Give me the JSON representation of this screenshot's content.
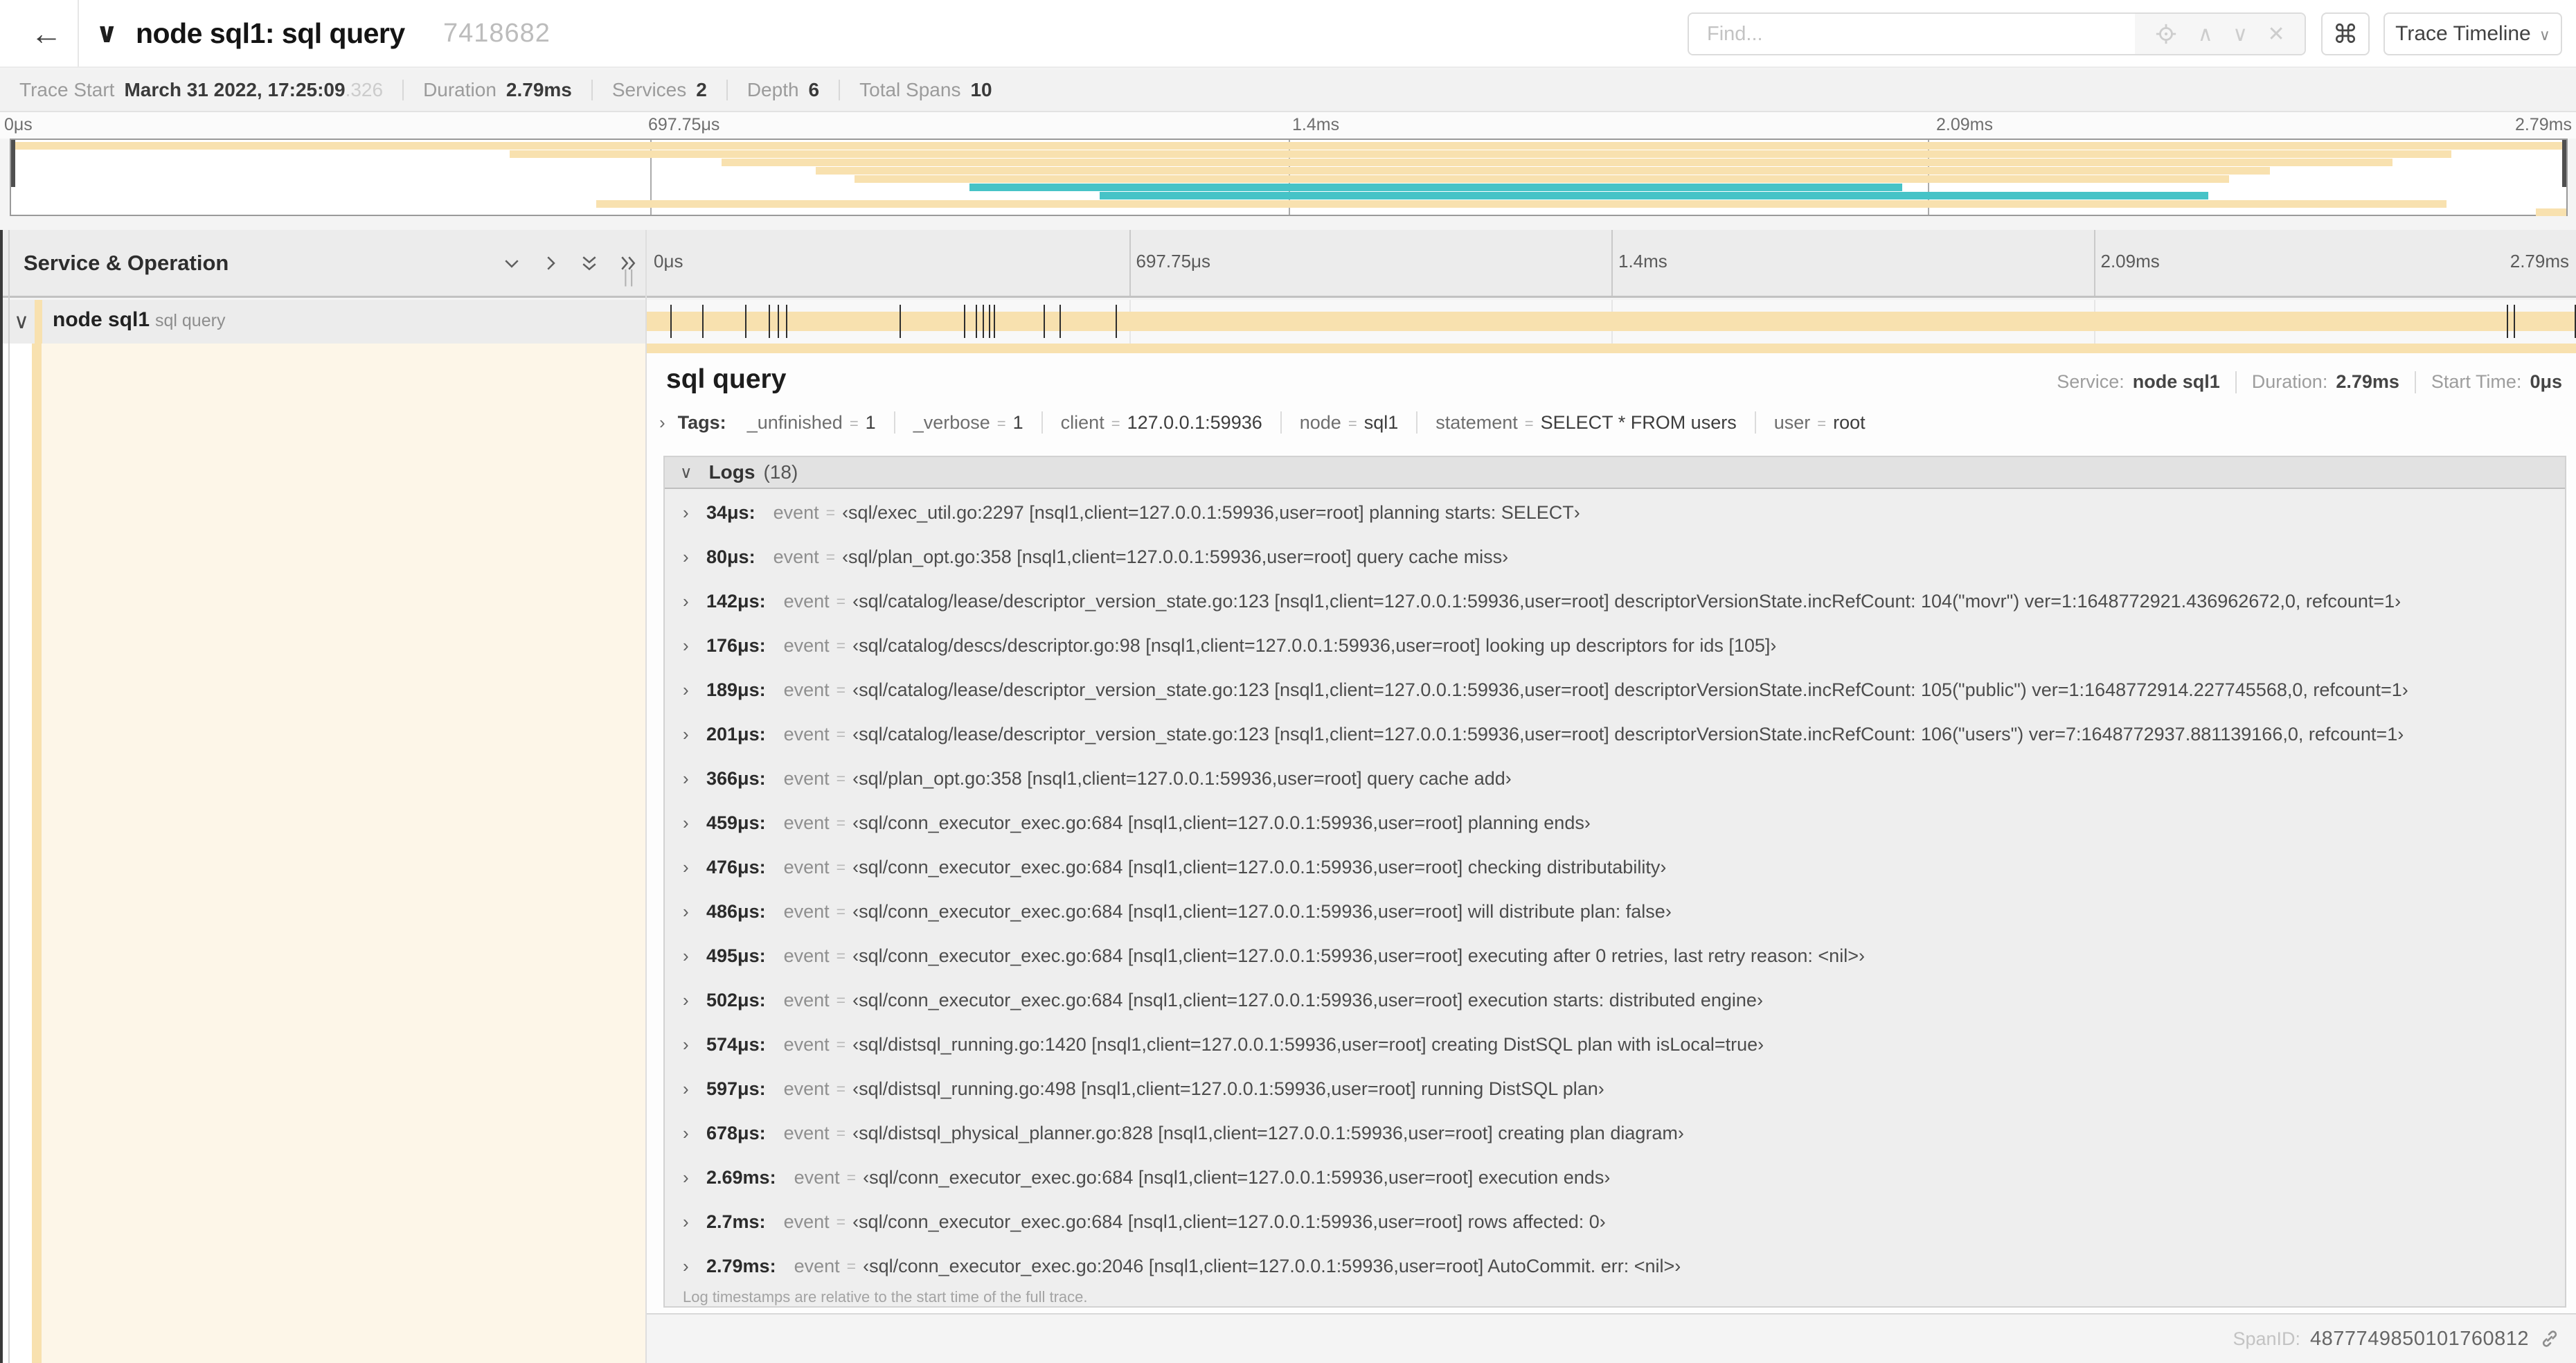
{
  "colors": {
    "tan": "#f8e1af",
    "teal": "#46c3c7",
    "cream": "#fdf6e8"
  },
  "header": {
    "title": "node sql1: sql query",
    "trace_id": "7418682",
    "find_placeholder": "Find...",
    "cmd_glyph": "⌘",
    "view_selector": "Trace Timeline"
  },
  "icons": {
    "back": "←",
    "title_chevron": "∨",
    "find_up": "∧",
    "find_down": "∨",
    "find_close": "✕",
    "caret_down": "∨",
    "chevron_down": "∨",
    "chevron_right": "›",
    "resize_grip": "||"
  },
  "summary": {
    "items": [
      {
        "label": "Trace Start",
        "value": "March 31 2022, 17:25:09",
        "muted": ".326"
      },
      {
        "label": "Duration",
        "value": "2.79ms",
        "muted": ""
      },
      {
        "label": "Services",
        "value": "2",
        "muted": ""
      },
      {
        "label": "Depth",
        "value": "6",
        "muted": ""
      },
      {
        "label": "Total Spans",
        "value": "10",
        "muted": ""
      }
    ]
  },
  "minimap": {
    "ticks": [
      "0μs",
      "697.75μs",
      "1.4ms",
      "2.09ms",
      "2.79ms"
    ],
    "spans": [
      {
        "start": 0,
        "end": 1,
        "color": "tan"
      },
      {
        "start": 0.195,
        "end": 0.955,
        "color": "tan"
      },
      {
        "start": 0.278,
        "end": 0.932,
        "color": "tan"
      },
      {
        "start": 0.315,
        "end": 0.884,
        "color": "tan"
      },
      {
        "start": 0.33,
        "end": 0.868,
        "color": "tan"
      },
      {
        "start": 0.375,
        "end": 0.74,
        "color": "teal"
      },
      {
        "start": 0.426,
        "end": 0.86,
        "color": "teal"
      },
      {
        "start": 0.229,
        "end": 0.953,
        "color": "tan"
      },
      {
        "start": 0.988,
        "end": 1,
        "color": "tan"
      }
    ]
  },
  "timeline": {
    "left_header": "Service & Operation",
    "ticks": [
      "0μs",
      "697.75μs",
      "1.4ms",
      "2.09ms",
      "2.79ms"
    ],
    "duration_us": 2790,
    "row": {
      "service": "node sql1",
      "operation": "sql query"
    }
  },
  "detail": {
    "title": "sql query",
    "meta": [
      {
        "label": "Service:",
        "value": "node sql1"
      },
      {
        "label": "Duration:",
        "value": "2.79ms"
      },
      {
        "label": "Start Time:",
        "value": "0μs"
      }
    ],
    "tags_label": "Tags:",
    "eq": "=",
    "tags": [
      {
        "key": "_unfinished",
        "value": "1"
      },
      {
        "key": "_verbose",
        "value": "1"
      },
      {
        "key": "client",
        "value": "127.0.0.1:59936"
      },
      {
        "key": "node",
        "value": "sql1"
      },
      {
        "key": "statement",
        "value": "SELECT * FROM users"
      },
      {
        "key": "user",
        "value": "root"
      }
    ],
    "logs_label": "Logs",
    "logs_count": "(18)",
    "log_field": "event",
    "logs": [
      {
        "time": "34μs:",
        "us": 34,
        "msg": "‹sql/exec_util.go:2297 [nsql1,client=127.0.0.1:59936,user=root] planning starts: SELECT›"
      },
      {
        "time": "80μs:",
        "us": 80,
        "msg": "‹sql/plan_opt.go:358 [nsql1,client=127.0.0.1:59936,user=root] query cache miss›"
      },
      {
        "time": "142μs:",
        "us": 142,
        "msg": "‹sql/catalog/lease/descriptor_version_state.go:123 [nsql1,client=127.0.0.1:59936,user=root] descriptorVersionState.incRefCount: 104(\"movr\") ver=1:1648772921.436962672,0, refcount=1›"
      },
      {
        "time": "176μs:",
        "us": 176,
        "msg": "‹sql/catalog/descs/descriptor.go:98 [nsql1,client=127.0.0.1:59936,user=root] looking up descriptors for ids [105]›"
      },
      {
        "time": "189μs:",
        "us": 189,
        "msg": "‹sql/catalog/lease/descriptor_version_state.go:123 [nsql1,client=127.0.0.1:59936,user=root] descriptorVersionState.incRefCount: 105(\"public\") ver=1:1648772914.227745568,0, refcount=1›"
      },
      {
        "time": "201μs:",
        "us": 201,
        "msg": "‹sql/catalog/lease/descriptor_version_state.go:123 [nsql1,client=127.0.0.1:59936,user=root] descriptorVersionState.incRefCount: 106(\"users\") ver=7:1648772937.881139166,0, refcount=1›"
      },
      {
        "time": "366μs:",
        "us": 366,
        "msg": "‹sql/plan_opt.go:358 [nsql1,client=127.0.0.1:59936,user=root] query cache add›"
      },
      {
        "time": "459μs:",
        "us": 459,
        "msg": "‹sql/conn_executor_exec.go:684 [nsql1,client=127.0.0.1:59936,user=root] planning ends›"
      },
      {
        "time": "476μs:",
        "us": 476,
        "msg": "‹sql/conn_executor_exec.go:684 [nsql1,client=127.0.0.1:59936,user=root] checking distributability›"
      },
      {
        "time": "486μs:",
        "us": 486,
        "msg": "‹sql/conn_executor_exec.go:684 [nsql1,client=127.0.0.1:59936,user=root] will distribute plan: false›"
      },
      {
        "time": "495μs:",
        "us": 495,
        "msg": "‹sql/conn_executor_exec.go:684 [nsql1,client=127.0.0.1:59936,user=root] executing after 0 retries, last retry reason: <nil>›"
      },
      {
        "time": "502μs:",
        "us": 502,
        "msg": "‹sql/conn_executor_exec.go:684 [nsql1,client=127.0.0.1:59936,user=root] execution starts: distributed engine›"
      },
      {
        "time": "574μs:",
        "us": 574,
        "msg": "‹sql/distsql_running.go:1420 [nsql1,client=127.0.0.1:59936,user=root] creating DistSQL plan with isLocal=true›"
      },
      {
        "time": "597μs:",
        "us": 597,
        "msg": "‹sql/distsql_running.go:498 [nsql1,client=127.0.0.1:59936,user=root] running DistSQL plan›"
      },
      {
        "time": "678μs:",
        "us": 678,
        "msg": "‹sql/distsql_physical_planner.go:828 [nsql1,client=127.0.0.1:59936,user=root] creating plan diagram›"
      },
      {
        "time": "2.69ms:",
        "us": 2690,
        "msg": "‹sql/conn_executor_exec.go:684 [nsql1,client=127.0.0.1:59936,user=root] execution ends›"
      },
      {
        "time": "2.7ms:",
        "us": 2700,
        "msg": "‹sql/conn_executor_exec.go:684 [nsql1,client=127.0.0.1:59936,user=root] rows affected: 0›"
      },
      {
        "time": "2.79ms:",
        "us": 2790,
        "msg": "‹sql/conn_executor_exec.go:2046 [nsql1,client=127.0.0.1:59936,user=root] AutoCommit. err: <nil>›"
      }
    ],
    "note": "Log timestamps are relative to the start time of the full trace.",
    "footer_label": "SpanID:",
    "footer_value": "4877749850101760812"
  }
}
